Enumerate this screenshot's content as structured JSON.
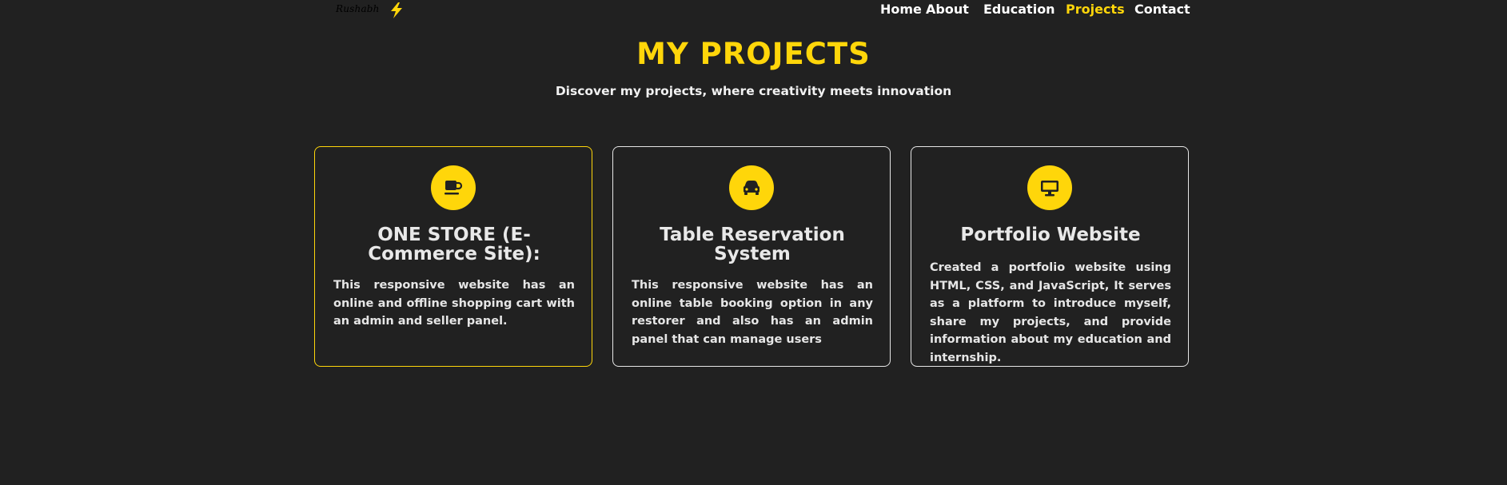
{
  "nav": {
    "logo_text": "Rushabh",
    "logo_icon": "lightning-bolt-icon",
    "items": [
      {
        "label": "Home"
      },
      {
        "label": "About"
      },
      {
        "label": "Education"
      },
      {
        "label": "Projects",
        "active": true
      },
      {
        "label": "Contact"
      }
    ]
  },
  "header": {
    "title": "MY PROJECTS",
    "subtitle": "Discover my projects, where creativity meets innovation"
  },
  "projects": [
    {
      "icon": "coffee-cup-icon",
      "title": "ONE STORE (E-Commerce Site):",
      "description": "This responsive website has an online and offline shopping cart with an admin and seller panel."
    },
    {
      "icon": "car-icon",
      "title": "Table Reservation System",
      "description": "This responsive website has an online table booking option in any restorer and also has an admin panel that can manage users"
    },
    {
      "icon": "desktop-monitor-icon",
      "title": "Portfolio Website",
      "description": "Created a portfolio website using HTML, CSS, and JavaScript, It serves as a platform to introduce myself, share my projects, and provide information about my education and internship."
    }
  ],
  "colors": {
    "background": "#212121",
    "accent": "#ffd60a",
    "text": "#ffffff",
    "card_border": "#e6e6e6"
  }
}
